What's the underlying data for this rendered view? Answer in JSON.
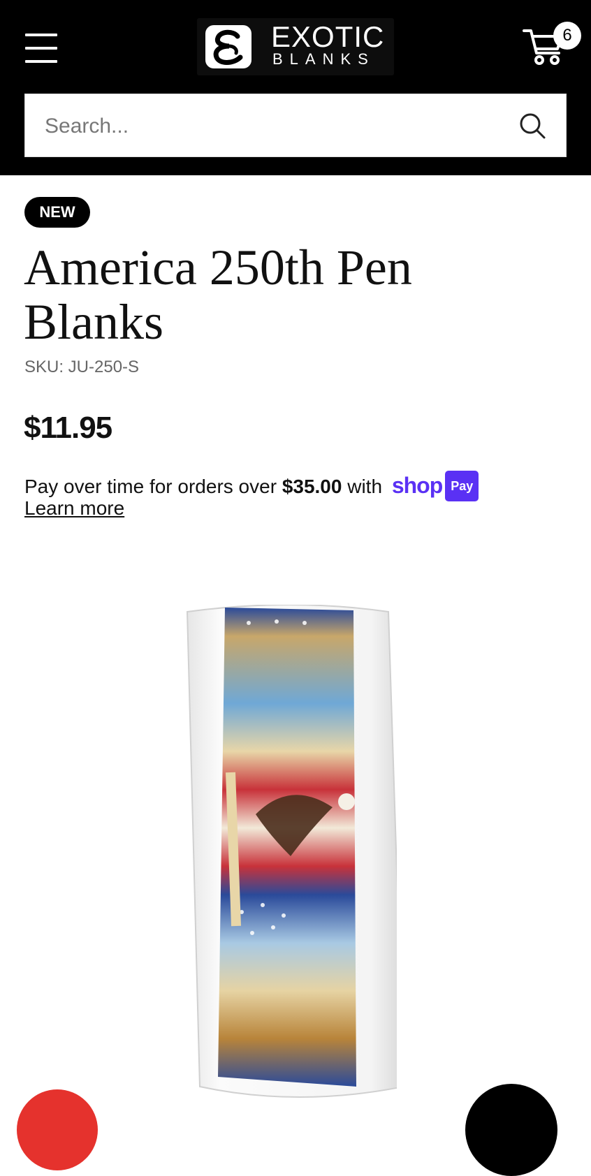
{
  "header": {
    "logo_line1": "EXOTIC",
    "logo_line2": "BLANKS",
    "cart_count": "6",
    "menu_icon": "hamburger-menu-icon",
    "cart_icon": "shopping-cart-icon"
  },
  "search": {
    "placeholder": "Search...",
    "icon": "search-icon"
  },
  "product": {
    "badge": "NEW",
    "title": "America 250th Pen Blanks",
    "sku": "SKU: JU-250-S",
    "price": "$11.95",
    "installments_prefix": "Pay over time for orders over",
    "installments_amount": "$35.00",
    "installments_with": "with",
    "shop_word": "shop",
    "pay_word": "Pay",
    "learn_more": "Learn more"
  },
  "colors": {
    "header_bg": "#000000",
    "shop_pay": "#5a31f4",
    "fab_red": "#e5322d"
  }
}
